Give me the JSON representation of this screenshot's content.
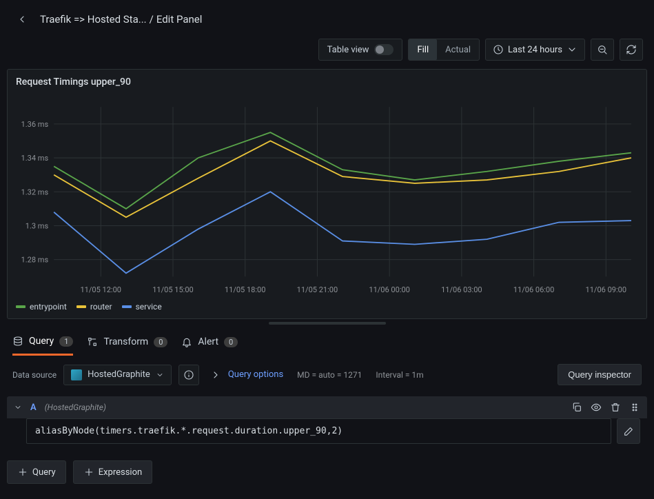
{
  "header": {
    "breadcrumb_dashboard": "Traefik => Hosted Sta...",
    "breadcrumb_sep": "/",
    "breadcrumb_page": "Edit Panel"
  },
  "toolbar": {
    "table_view_label": "Table view",
    "fill_label": "Fill",
    "actual_label": "Actual",
    "time_range_label": "Last 24 hours"
  },
  "panel": {
    "title": "Request Timings upper_90"
  },
  "chart_data": {
    "type": "line",
    "title": "Request Timings upper_90",
    "ylabel": "",
    "xlabel": "",
    "ylim": [
      1.27,
      1.37
    ],
    "y_ticks": [
      "1.36 ms",
      "1.34 ms",
      "1.32 ms",
      "1.3 ms",
      "1.28 ms"
    ],
    "categories": [
      "11/05 12:00",
      "11/05 15:00",
      "11/05 18:00",
      "11/05 21:00",
      "11/06 00:00",
      "11/06 03:00",
      "11/06 06:00",
      "11/06 09:00"
    ],
    "x": [
      0,
      1,
      2,
      3,
      4,
      5,
      6,
      7,
      8
    ],
    "series": [
      {
        "name": "entrypoint",
        "color": "#5aa64a",
        "values": [
          1.335,
          1.31,
          1.34,
          1.355,
          1.333,
          1.327,
          1.332,
          1.338,
          1.343
        ]
      },
      {
        "name": "router",
        "color": "#e9c33a",
        "values": [
          1.33,
          1.305,
          1.328,
          1.35,
          1.329,
          1.325,
          1.327,
          1.332,
          1.34
        ]
      },
      {
        "name": "service",
        "color": "#5a8fe6",
        "values": [
          1.308,
          1.272,
          1.298,
          1.32,
          1.291,
          1.289,
          1.292,
          1.302,
          1.303
        ]
      }
    ],
    "legend": [
      "entrypoint",
      "router",
      "service"
    ],
    "legend_colors": [
      "#5aa64a",
      "#e9c33a",
      "#5a8fe6"
    ]
  },
  "tabs": {
    "query": {
      "label": "Query",
      "count": "1",
      "active": true
    },
    "transform": {
      "label": "Transform",
      "count": "0",
      "active": false
    },
    "alert": {
      "label": "Alert",
      "count": "0",
      "active": false
    }
  },
  "datasource": {
    "label": "Data source",
    "name": "HostedGraphite",
    "query_options_label": "Query options",
    "md_label": "MD = auto = 1271",
    "interval_label": "Interval = 1m",
    "inspector_label": "Query inspector"
  },
  "query": {
    "ref": "A",
    "ds_inline": "(HostedGraphite)",
    "expr": "aliasByNode(timers.traefik.*.request.duration.upper_90,2)"
  },
  "actions": {
    "add_query": "Query",
    "add_expression": "Expression"
  }
}
